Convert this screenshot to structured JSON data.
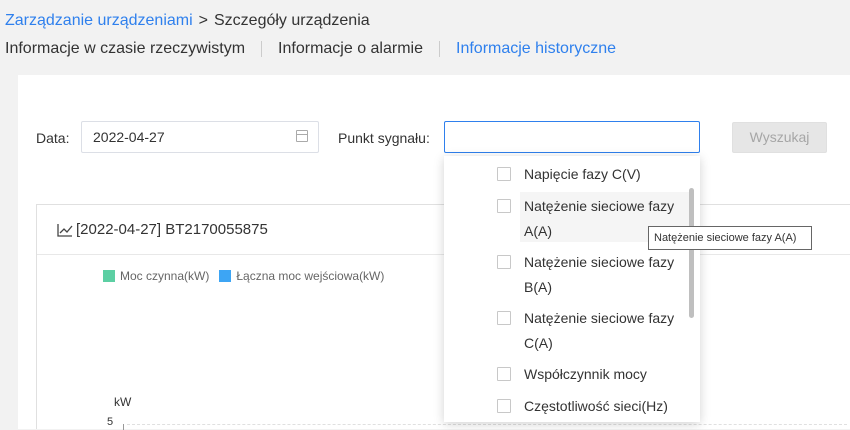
{
  "breadcrumb": {
    "parent": "Zarządzanie urządzeniami",
    "separator": ">",
    "current": "Szczegóły urządzenia"
  },
  "tabs": [
    {
      "label": "Informacje w czasie rzeczywistym",
      "active": false
    },
    {
      "label": "Informacje o alarmie",
      "active": false
    },
    {
      "label": "Informacje historyczne",
      "active": true
    }
  ],
  "filters": {
    "date_label": "Data",
    "date_value": "2022-04-27",
    "signal_label": "Punkt sygnału",
    "signal_value": "",
    "search_button": "Wyszukaj"
  },
  "chart": {
    "title": "[2022-04-27] BT2170055875",
    "legend": [
      {
        "name": "Moc czynna(kW)",
        "color": "#5ccfa3"
      },
      {
        "name": "Łączna moc wejściowa(kW)",
        "color": "#3da5f4"
      }
    ],
    "y_unit": "kW",
    "y_tick": "5"
  },
  "dropdown": {
    "options": [
      {
        "line1": "Napięcie fazy C(V)",
        "line2": ""
      },
      {
        "line1": "Natężenie sieciowe fazy",
        "line2": "A(A)"
      },
      {
        "line1": "Natężenie sieciowe fazy",
        "line2": "B(A)"
      },
      {
        "line1": "Natężenie sieciowe fazy",
        "line2": "C(A)"
      },
      {
        "line1": "Współczynnik mocy",
        "line2": ""
      },
      {
        "line1": "Częstotliwość sieci(Hz)",
        "line2": ""
      }
    ],
    "tooltip": "Natężenie sieciowe fazy A(A)"
  },
  "colors": {
    "accent": "#2f80ed",
    "legend_green": "#5ccfa3",
    "legend_blue": "#3da5f4"
  }
}
